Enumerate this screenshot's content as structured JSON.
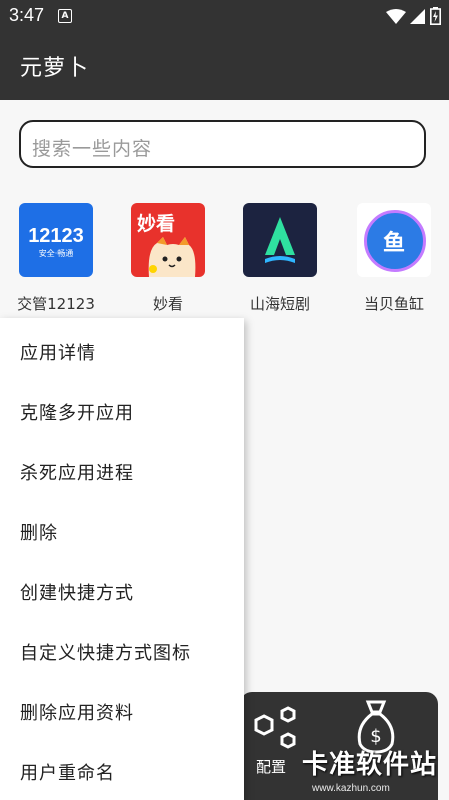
{
  "status_bar": {
    "time": "3:47",
    "notif_icon": "A"
  },
  "app_bar": {
    "title": "元萝卜"
  },
  "search": {
    "placeholder": "搜索一些内容"
  },
  "apps": [
    {
      "label": "交管12123",
      "icon": "jiaoguan-icon",
      "icon_text": "12123",
      "icon_sub": "安全·畅通",
      "color": "#1e6fe6"
    },
    {
      "label": "妙看",
      "icon": "miaokan-icon",
      "icon_text": "妙看",
      "color": "#e8322c"
    },
    {
      "label": "山海短剧",
      "icon": "shanhai-icon",
      "color": "#1c2340"
    },
    {
      "label": "当贝鱼缸",
      "icon": "dangbei-icon",
      "icon_text": "鱼",
      "color": "#2c7be5"
    }
  ],
  "menu": {
    "items": [
      "应用详情",
      "克隆多开应用",
      "杀死应用进程",
      "删除",
      "创建快捷方式",
      "自定义快捷方式图标",
      "删除应用资料",
      "用户重命名"
    ]
  },
  "bottom_bar": {
    "config_label": "配置"
  },
  "watermark": {
    "text": "卡准软件站",
    "url": "www.kazhun.com"
  }
}
